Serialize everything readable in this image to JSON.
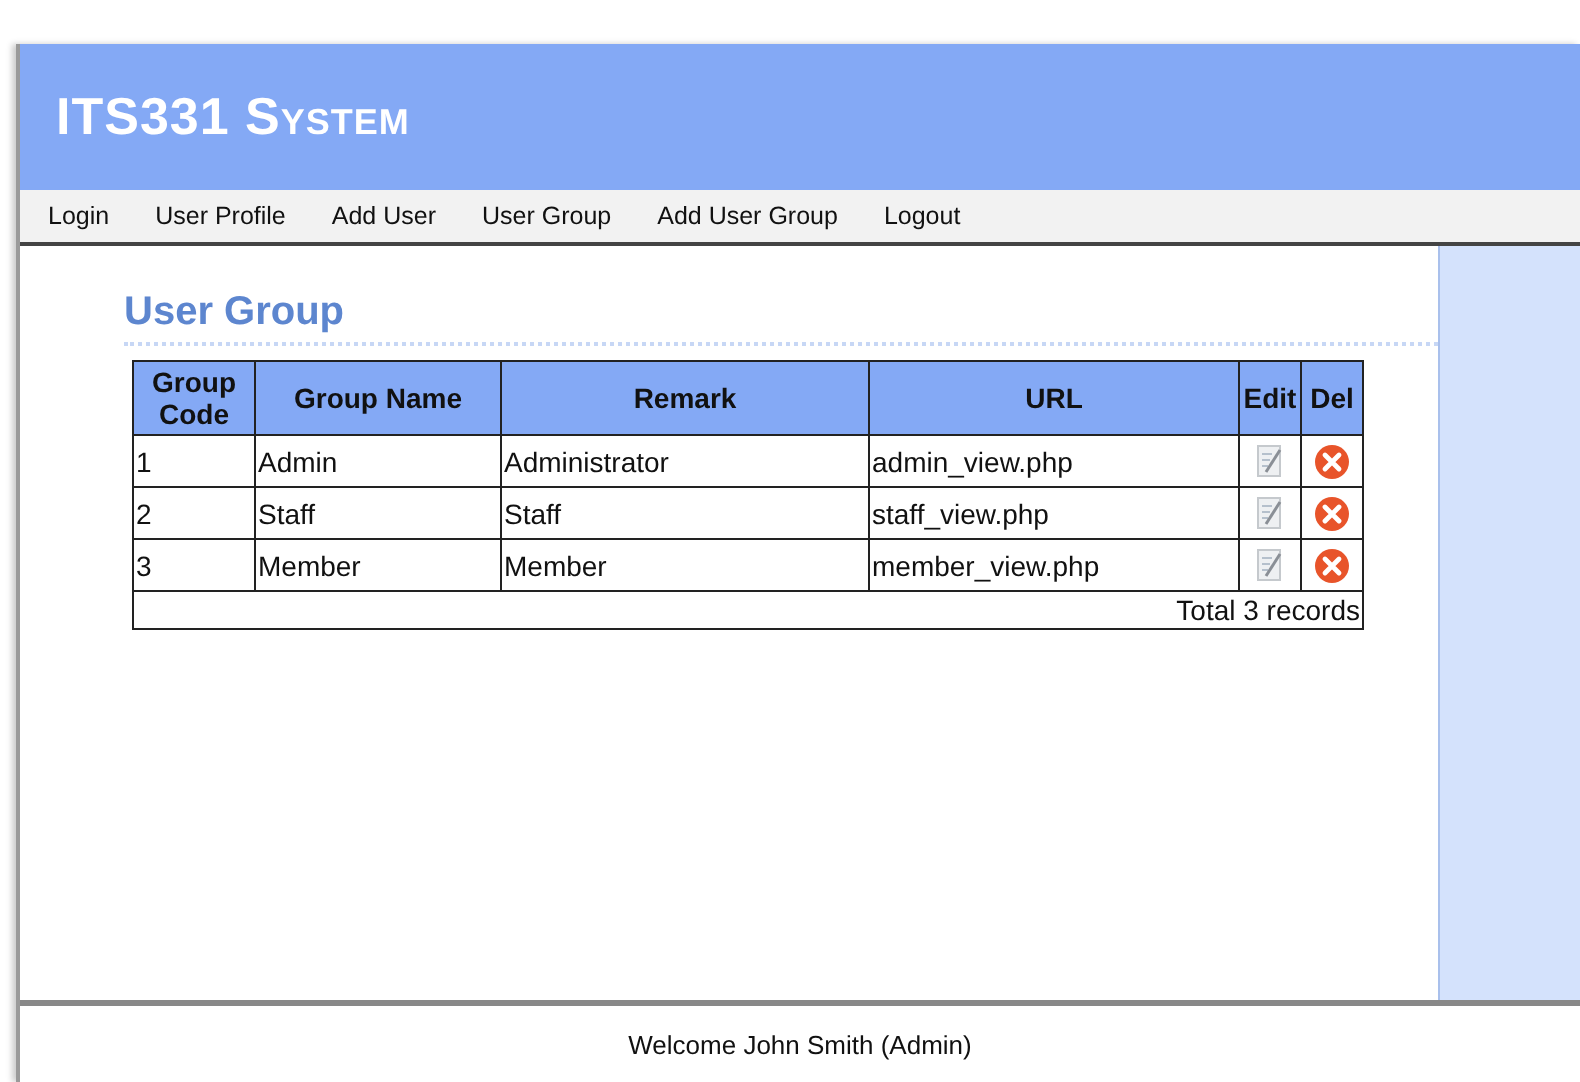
{
  "header": {
    "title": "ITS331 System"
  },
  "nav": [
    "Login",
    "User Profile",
    "Add User",
    "User Group",
    "Add User Group",
    "Logout"
  ],
  "page_title": "User Group",
  "table": {
    "columns": [
      "Group Code",
      "Group Name",
      "Remark",
      "URL",
      "Edit",
      "Del"
    ],
    "rows": [
      {
        "code": "1",
        "name": "Admin",
        "remark": "Administrator",
        "url": "admin_view.php"
      },
      {
        "code": "2",
        "name": "Staff",
        "remark": "Staff",
        "url": "staff_view.php"
      },
      {
        "code": "3",
        "name": "Member",
        "remark": "Member",
        "url": "member_view.php"
      }
    ],
    "total": "Total 3 records"
  },
  "footer": "Welcome John Smith (Admin)"
}
